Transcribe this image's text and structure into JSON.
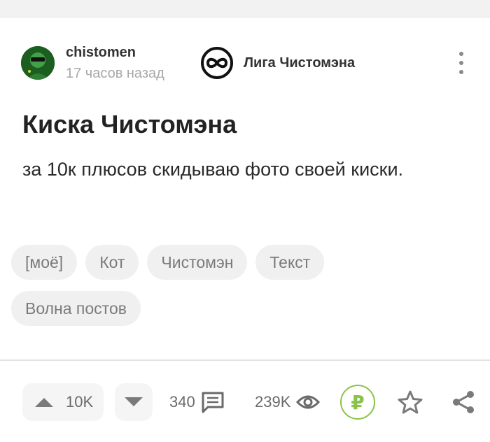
{
  "post": {
    "author": "chistomen",
    "time": "17 часов назад",
    "community": "Лига Чистомэна",
    "title": "Киска Чистомэна",
    "body": "за 10к плюсов скидываю фото своей киски.",
    "tags": [
      "[моё]",
      "Кот",
      "Чистомэн",
      "Текст",
      "Волна постов"
    ]
  },
  "footer": {
    "rating": "10K",
    "comments": "340",
    "views": "239K",
    "donate_symbol": "₽"
  },
  "icons": {
    "upvote": "triangle-up-icon",
    "downvote": "triangle-down-icon",
    "comments": "comment-icon",
    "views": "eye-icon",
    "save": "star-icon",
    "share": "share-icon",
    "menu": "more-vertical-icon"
  },
  "colors": {
    "accent_green": "#8bc34a",
    "muted_text": "#a8a8a8"
  }
}
